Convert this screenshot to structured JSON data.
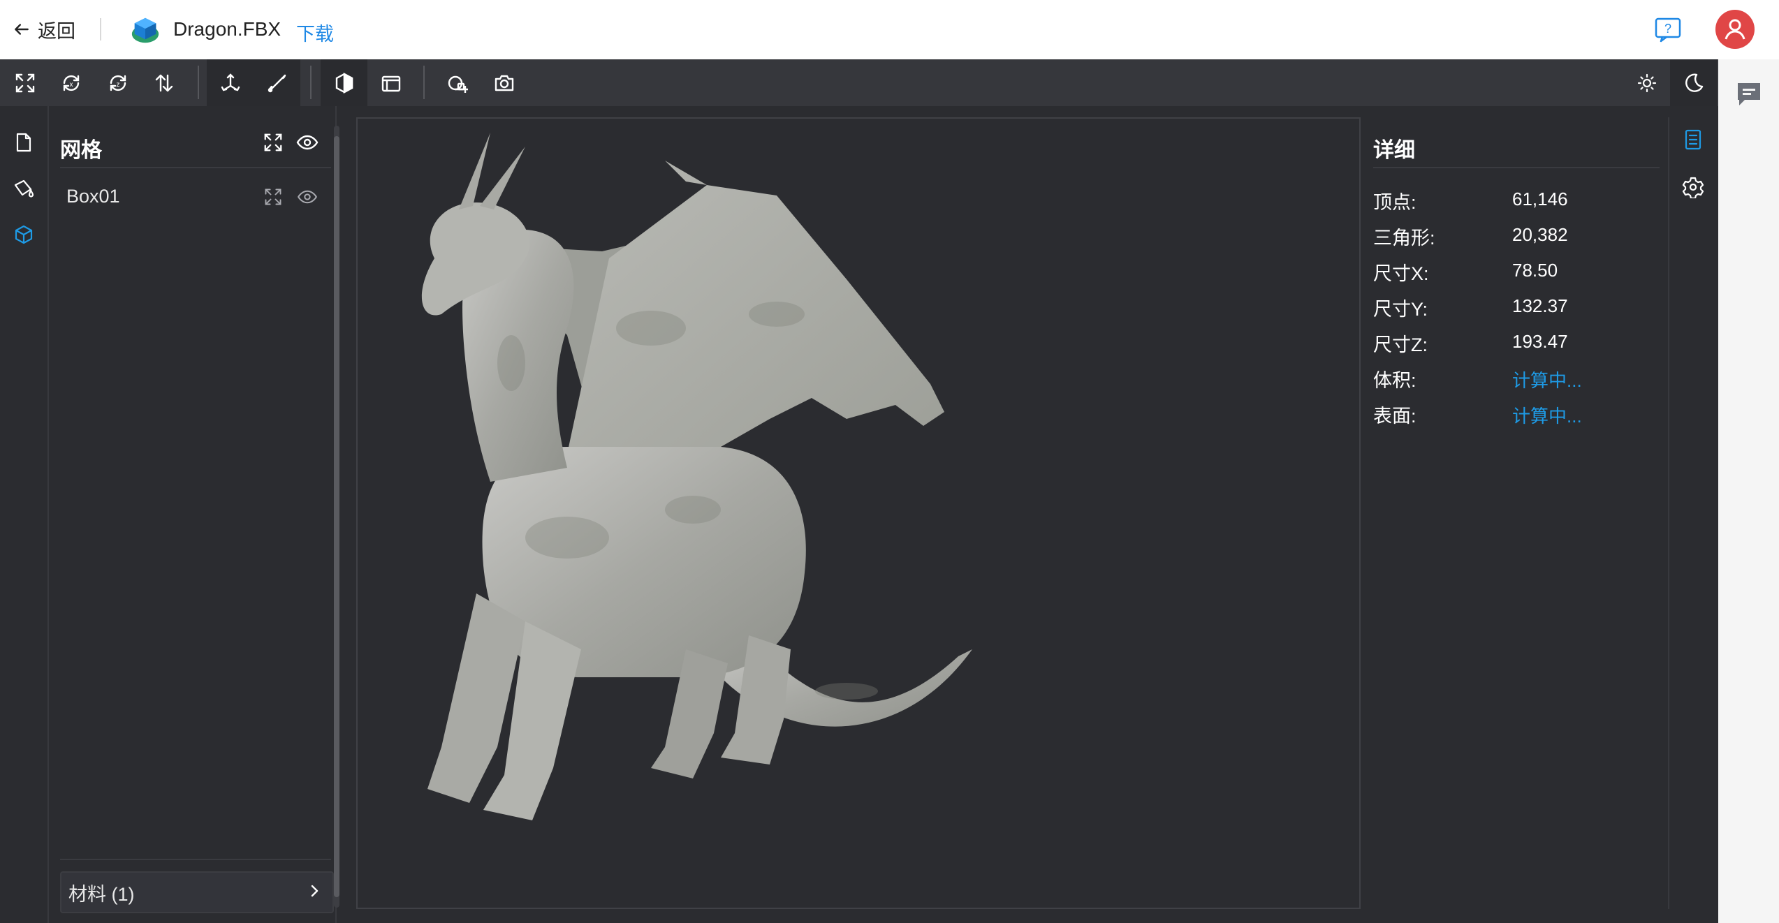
{
  "topbar": {
    "back_label": "返回",
    "filename": "Dragon.FBX",
    "download_label": "下载"
  },
  "toolbar": {
    "icons": [
      "fit-view-icon",
      "rotate-x-icon",
      "rotate-z-icon",
      "flip-up-down-icon",
      "axis-icon",
      "measure-icon",
      "shading-icon",
      "projection-icon",
      "environment-icon",
      "screenshot-icon",
      "light-theme-icon",
      "dark-theme-icon"
    ]
  },
  "left_panel": {
    "title": "网格",
    "meshes": [
      {
        "name": "Box01"
      }
    ],
    "materials_label": "材料 (1)"
  },
  "details": {
    "title": "详细",
    "rows": [
      {
        "label": "顶点:",
        "value": "61,146"
      },
      {
        "label": "三角形:",
        "value": "20,382"
      },
      {
        "label": "尺寸X:",
        "value": "78.50"
      },
      {
        "label": "尺寸Y:",
        "value": "132.37"
      },
      {
        "label": "尺寸Z:",
        "value": "193.47"
      },
      {
        "label": "体积:",
        "value": "计算中..."
      },
      {
        "label": "表面:",
        "value": "计算中..."
      }
    ]
  },
  "colors": {
    "accent": "#1e9be6",
    "panel_bg": "#2b2c30",
    "toolbar_bg": "#36373c",
    "avatar": "#e04646"
  }
}
